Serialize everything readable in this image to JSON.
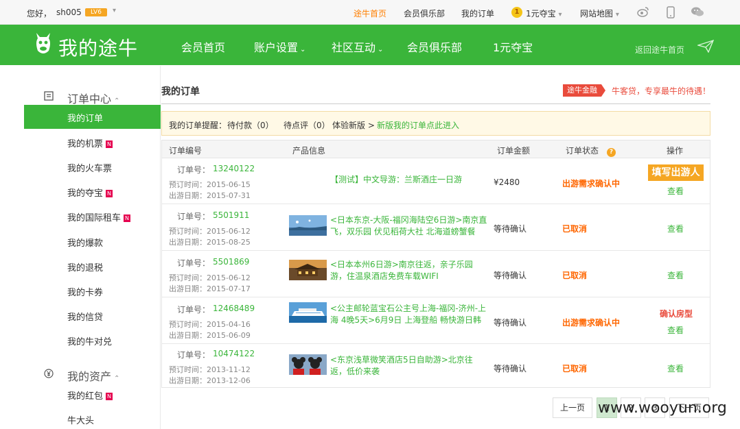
{
  "topbar": {
    "greeting": "您好，",
    "username": "sh005",
    "level": "LV6",
    "links": {
      "home": "途牛首页",
      "club": "会员俱乐部",
      "orders": "我的订单",
      "coin_label": "1",
      "treasure": "1元夺宝",
      "sitemap": "网站地图"
    },
    "icons": [
      "weibo-icon",
      "phone-icon",
      "wechat-icon"
    ]
  },
  "header": {
    "logo": "我的途牛",
    "nav": [
      "会员首页",
      "账户设置",
      "社区互动",
      "会员俱乐部",
      "1元夺宝"
    ],
    "back_home": "返回途牛首页"
  },
  "sidebar": {
    "order_center": "订单中心",
    "order_items": [
      {
        "label": "我的订单",
        "new": false,
        "active": true
      },
      {
        "label": "我的机票",
        "new": true,
        "active": false
      },
      {
        "label": "我的火车票",
        "new": false,
        "active": false
      },
      {
        "label": "我的夺宝",
        "new": true,
        "active": false
      },
      {
        "label": "我的国际租车",
        "new": true,
        "active": false
      },
      {
        "label": "我的爆款",
        "new": false,
        "active": false
      },
      {
        "label": "我的退税",
        "new": false,
        "active": false
      },
      {
        "label": "我的卡券",
        "new": false,
        "active": false
      },
      {
        "label": "我的信贷",
        "new": false,
        "active": false
      },
      {
        "label": "我的牛对兑",
        "new": false,
        "active": false
      }
    ],
    "assets": "我的资产",
    "asset_items": [
      {
        "label": "我的红包",
        "new": true
      },
      {
        "label": "牛大头",
        "new": false
      }
    ],
    "new_tag": "N"
  },
  "main": {
    "title": "我的订单",
    "finance_badge": "途牛金融",
    "finance_text": "牛客贷，专享最牛的待遇！",
    "reminder": {
      "label": "我的订单提醒：",
      "pending_pay": "待付款（0）",
      "pending_review": "待点评（0）",
      "new_version": "体验新版 >",
      "new_link": "新版我的订单点此进入"
    },
    "columns": [
      "订单编号",
      "产品信息",
      "订单金额",
      "订单状态",
      "操作"
    ],
    "help": "?",
    "orders": [
      {
        "no_label": "订单号：",
        "no": "13240122",
        "booked": "预订时间：2015-06-15",
        "travel": "出游日期：2015-07-31",
        "product": "【测试】中文导游：兰斯酒庄一日游",
        "amount": "¥2480",
        "status": "出游需求确认中",
        "action_primary": "填写出游人",
        "action_view": "查看"
      },
      {
        "no_label": "订单号：",
        "no": "5501911",
        "booked": "预订时间：2015-06-12",
        "travel": "出游日期：2015-08-25",
        "product": "<日本东京-大阪-福冈海陆空6日游>南京直飞，双乐园 伏见稻荷大社 北海道螃蟹餐",
        "amount": "等待确认",
        "status": "已取消",
        "action_view": "查看"
      },
      {
        "no_label": "订单号：",
        "no": "5501869",
        "booked": "预订时间：2015-06-12",
        "travel": "出游日期：2015-07-17",
        "product": "<日本本州6日游>南京往返，亲子乐园游，住温泉酒店免费车载WIFI",
        "amount": "等待确认",
        "status": "已取消",
        "action_view": "查看"
      },
      {
        "no_label": "订单号：",
        "no": "12468489",
        "booked": "预订时间：2015-04-16",
        "travel": "出游日期：2015-06-09",
        "product": "<公主邮轮蓝宝石公主号上海-福冈-济州-上海 4晚5天>6月9日 上海登船 畅快游日韩",
        "amount": "等待确认",
        "status": "出游需求确认中",
        "action_confirm": "确认房型",
        "action_view": "查看"
      },
      {
        "no_label": "订单号：",
        "no": "10474122",
        "booked": "预订时间：2013-11-12",
        "travel": "出游日期：2013-12-06",
        "product": "<东京浅草微笑酒店5日自助游>北京往返，低价来袭",
        "amount": "等待确认",
        "status": "已取消",
        "action_view": "查看"
      }
    ],
    "pager": {
      "prev": "上一页",
      "next": "下一页",
      "pages": [
        "1",
        "2",
        "3"
      ]
    },
    "watermark": "www.wooyun.org"
  },
  "colors": {
    "green": "#3ab53a",
    "orange": "#f60",
    "red": "#e94b3c"
  }
}
